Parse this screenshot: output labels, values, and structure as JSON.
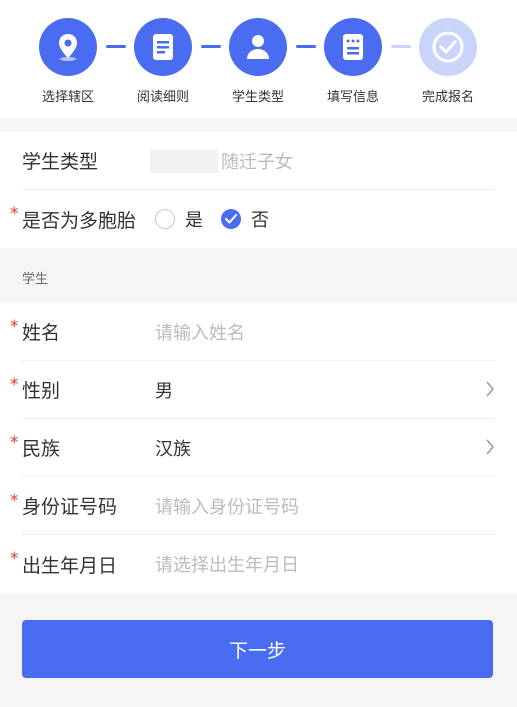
{
  "steps": [
    {
      "label": "选择辖区",
      "icon": "location-pin-icon",
      "state": "done"
    },
    {
      "label": "阅读细则",
      "icon": "document-icon",
      "state": "done"
    },
    {
      "label": "学生类型",
      "icon": "user-icon",
      "state": "active"
    },
    {
      "label": "填写信息",
      "icon": "form-icon",
      "state": "active"
    },
    {
      "label": "完成报名",
      "icon": "check-circle-icon",
      "state": "pending"
    }
  ],
  "student_type": {
    "label": "学生类型",
    "value": "随迁子女"
  },
  "multiple_birth": {
    "label": "是否为多胞胎",
    "option_yes": "是",
    "option_no": "否",
    "selected": "否"
  },
  "section": {
    "title": "学生"
  },
  "fields": {
    "name": {
      "label": "姓名",
      "placeholder": "请输入姓名"
    },
    "gender": {
      "label": "性别",
      "value": "男"
    },
    "ethnicity": {
      "label": "民族",
      "value": "汉族"
    },
    "id_number": {
      "label": "身份证号码",
      "placeholder": "请输入身份证号码"
    },
    "birthdate": {
      "label": "出生年月日",
      "placeholder": "请选择出生年月日"
    }
  },
  "next_button": "下一步",
  "colors": {
    "accent": "#4a6cf0",
    "pending": "#c9d4fb",
    "required": "#e53935"
  }
}
